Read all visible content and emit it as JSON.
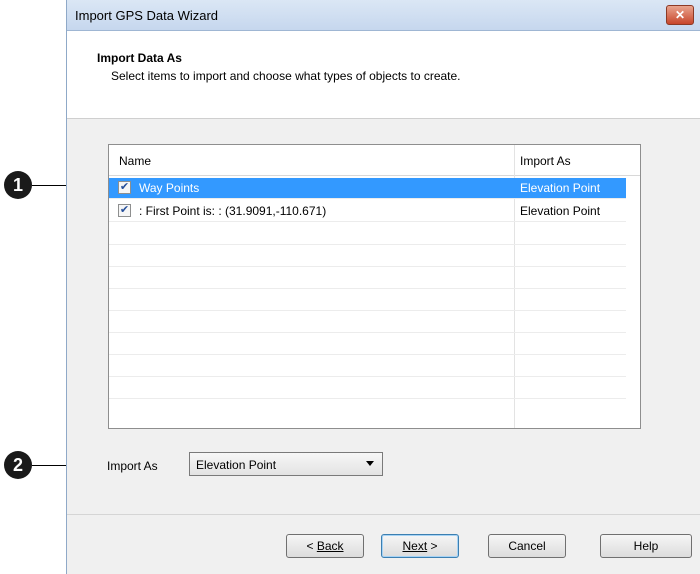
{
  "callouts": [
    "1",
    "2"
  ],
  "window": {
    "title": "Import GPS Data Wizard",
    "close_icon": "close-icon"
  },
  "header": {
    "title": "Import Data As",
    "description": "Select items to import and choose what types of objects to create."
  },
  "list": {
    "columns": [
      "Name",
      "Import As"
    ],
    "rows": [
      {
        "name": "Way Points",
        "import_as": "Elevation Point",
        "checked": true,
        "selected": true
      },
      {
        "name": ": First Point is: : (31.9091,-110.671)",
        "import_as": "Elevation Point",
        "checked": true,
        "selected": false
      }
    ]
  },
  "import_as": {
    "label": "Import As",
    "value": "Elevation Point"
  },
  "buttons": {
    "back": "Back",
    "next": "Next",
    "cancel": "Cancel",
    "help": "Help"
  },
  "colors": {
    "selection": "#3399ff"
  }
}
